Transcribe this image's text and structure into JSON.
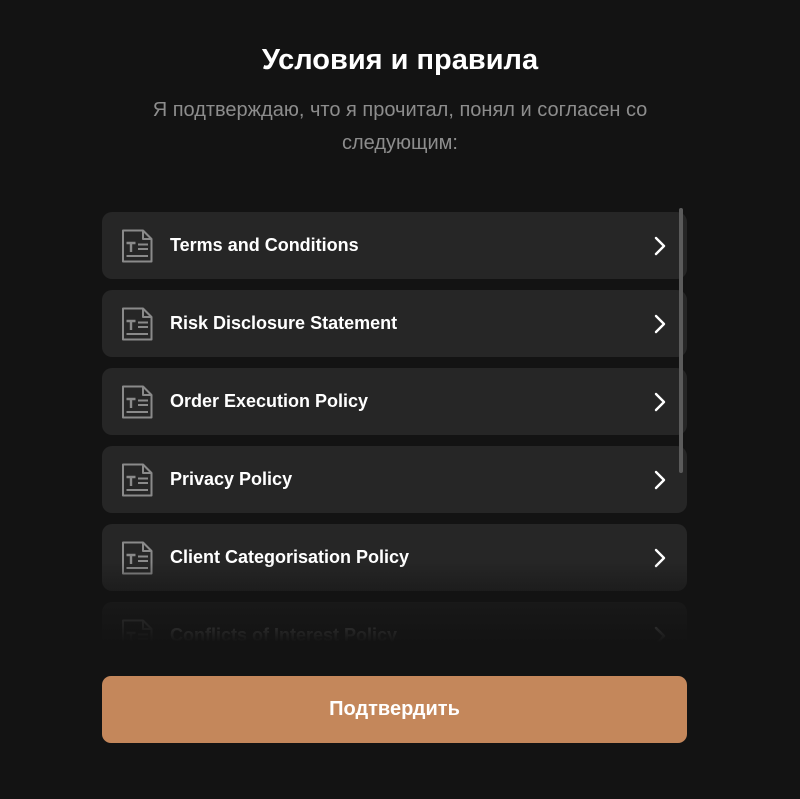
{
  "header": {
    "title": "Условия и правила",
    "subtitle": "Я подтверждаю, что я прочитал, понял и согласен со следующим:"
  },
  "documents": {
    "items": [
      {
        "label": "Terms and Conditions",
        "icon": "document-text-icon"
      },
      {
        "label": "Risk Disclosure Statement",
        "icon": "document-text-icon"
      },
      {
        "label": "Order Execution Policy",
        "icon": "document-text-icon"
      },
      {
        "label": "Privacy Policy",
        "icon": "document-text-icon"
      },
      {
        "label": "Client Categorisation Policy",
        "icon": "document-text-icon"
      },
      {
        "label": "Conflicts of Interest Policy",
        "icon": "document-text-icon"
      }
    ]
  },
  "footer": {
    "confirm_label": "Подтвердить"
  },
  "colors": {
    "background": "#131313",
    "card": "#262626",
    "accent": "#c4875b",
    "subtitle_text": "#8d8d8d"
  }
}
